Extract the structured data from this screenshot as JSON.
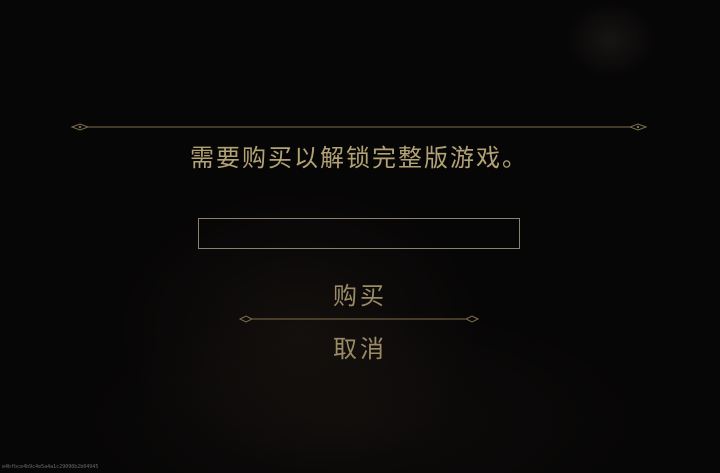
{
  "dialog": {
    "message": "需要购买以解锁完整版游戏。",
    "input": {
      "value": "",
      "placeholder": ""
    },
    "buy_label": "购买",
    "cancel_label": "取消"
  },
  "footer": {
    "version": "e4bfbce4b9c4e5a4a1c29090b2b04945"
  },
  "colors": {
    "text_gold": "#b3a274",
    "button_gold": "#9b8c66",
    "divider": "#7d6e4c",
    "input_border": "#8a8270",
    "background": "#070606"
  }
}
